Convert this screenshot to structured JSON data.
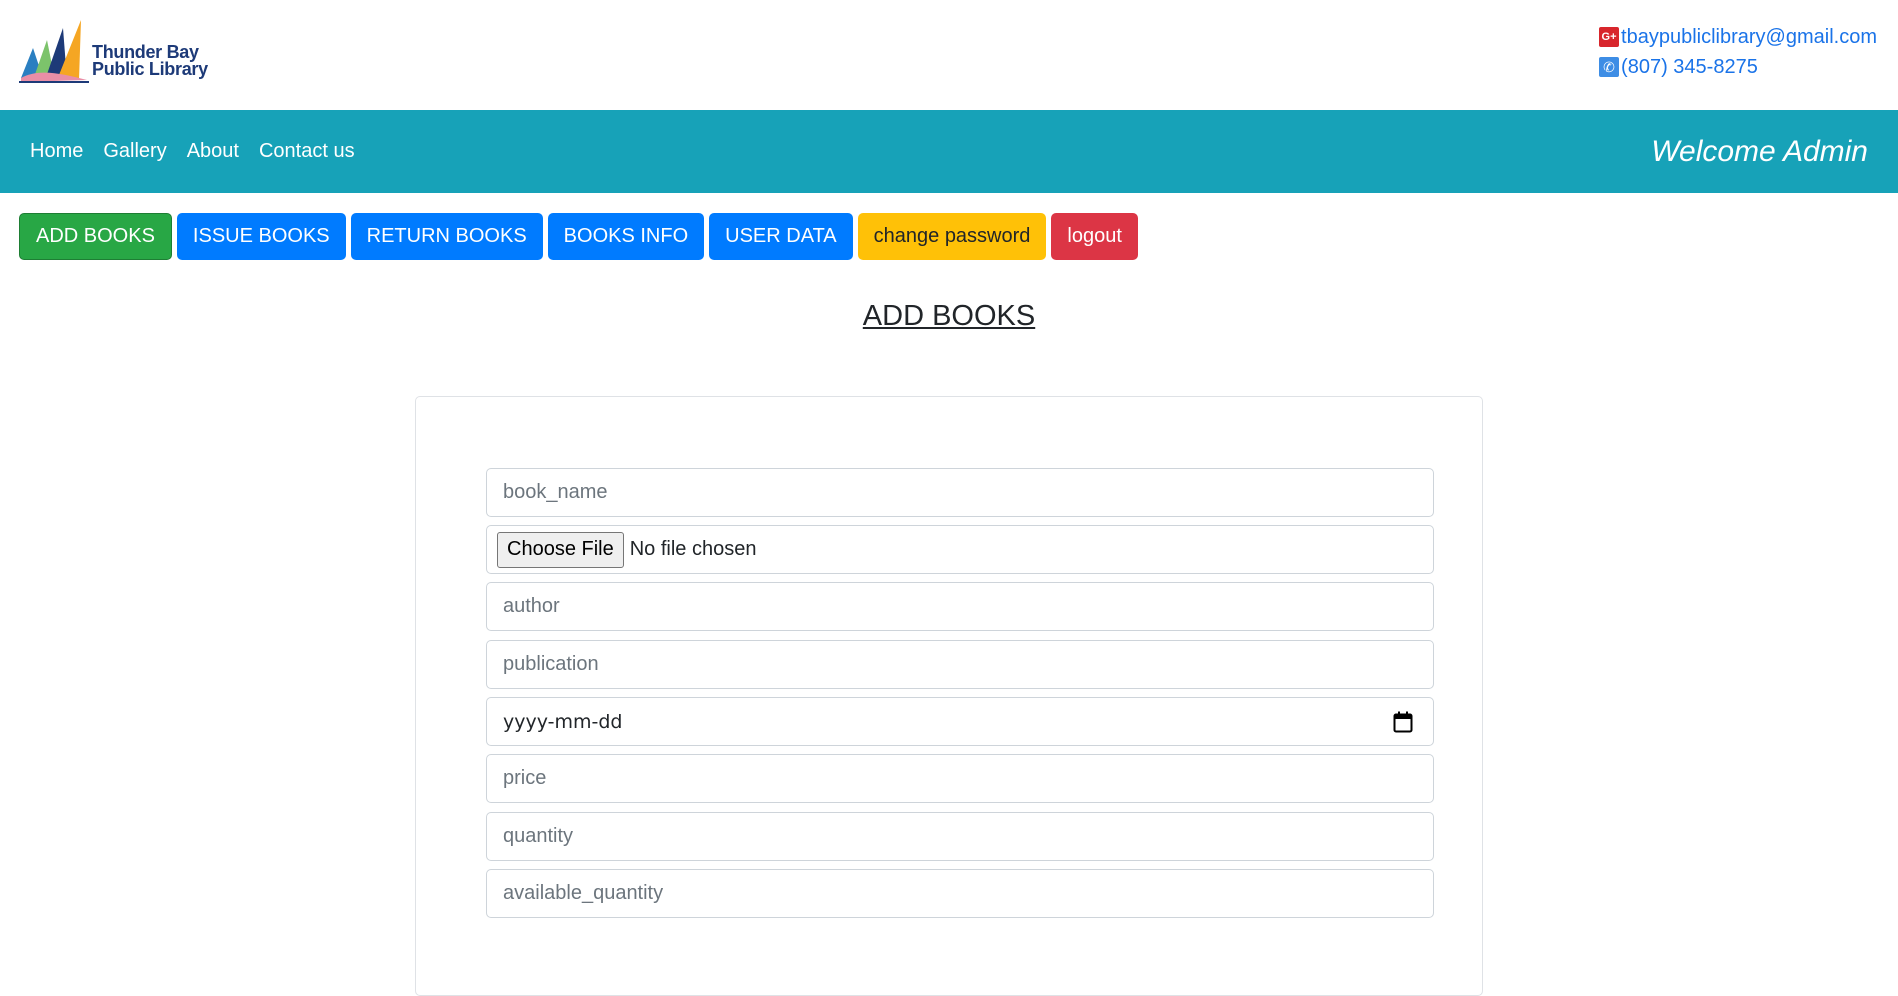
{
  "brand": {
    "name_line1": "Thunder Bay",
    "name_line2": "Public Library"
  },
  "contact": {
    "email": "tbaypubliclibrary@gmail.com",
    "phone": "(807) 345-8275",
    "email_icon": "google-plus-icon",
    "phone_icon": "phone-icon",
    "gplus_glyph": "G+"
  },
  "nav": {
    "links": [
      "Home",
      "Gallery",
      "About",
      "Contact us"
    ],
    "welcome": "Welcome Admin",
    "color": "#17a2b8"
  },
  "actions": [
    {
      "label": "ADD BOOKS",
      "color": "#28a745"
    },
    {
      "label": "ISSUE BOOKS",
      "color": "#007bff"
    },
    {
      "label": "RETURN BOOKS",
      "color": "#007bff"
    },
    {
      "label": "BOOKS INFO",
      "color": "#007bff"
    },
    {
      "label": "USER DATA",
      "color": "#007bff"
    },
    {
      "label": "change password",
      "color": "#ffc107"
    },
    {
      "label": "logout",
      "color": "#dc3545"
    }
  ],
  "page_title": "ADD BOOKS",
  "form": {
    "book_name_placeholder": "book_name",
    "file_button": "Choose File",
    "file_status": "No file chosen",
    "author_placeholder": "author",
    "publication_placeholder": "publication",
    "date_placeholder": "yyyy-mm-dd",
    "price_placeholder": "price",
    "quantity_placeholder": "quantity",
    "available_quantity_placeholder": "available_quantity"
  }
}
